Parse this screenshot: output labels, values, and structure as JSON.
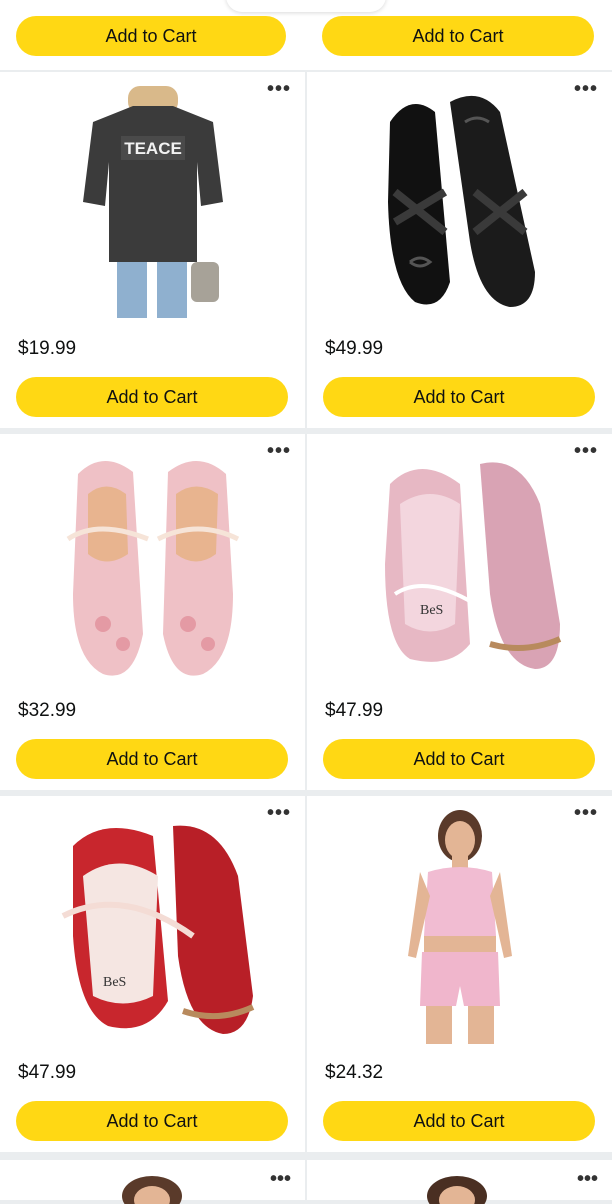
{
  "top_row": {
    "left_button": "Add to Cart",
    "right_button": "Add to Cart"
  },
  "products": [
    {
      "price": "$19.99",
      "button": "Add to Cart",
      "image": "charcoal oversized graphic t-shirt"
    },
    {
      "price": "$49.99",
      "button": "Add to Cart",
      "image": "black ballet flats"
    },
    {
      "price": "$32.99",
      "button": "Add to Cart",
      "image": "pink floral bow flats"
    },
    {
      "price": "$47.99",
      "button": "Add to Cart",
      "image": "pink lace-trim sneakers"
    },
    {
      "price": "$47.99",
      "button": "Add to Cart",
      "image": "red lace-trim sneakers"
    },
    {
      "price": "$24.32",
      "button": "Add to Cart",
      "image": "pink two-piece outfit"
    }
  ],
  "colors": {
    "button": "#ffd814",
    "card": "#ffffff",
    "gutter": "#eaedef"
  },
  "more_icon": "ellipsis-icon"
}
